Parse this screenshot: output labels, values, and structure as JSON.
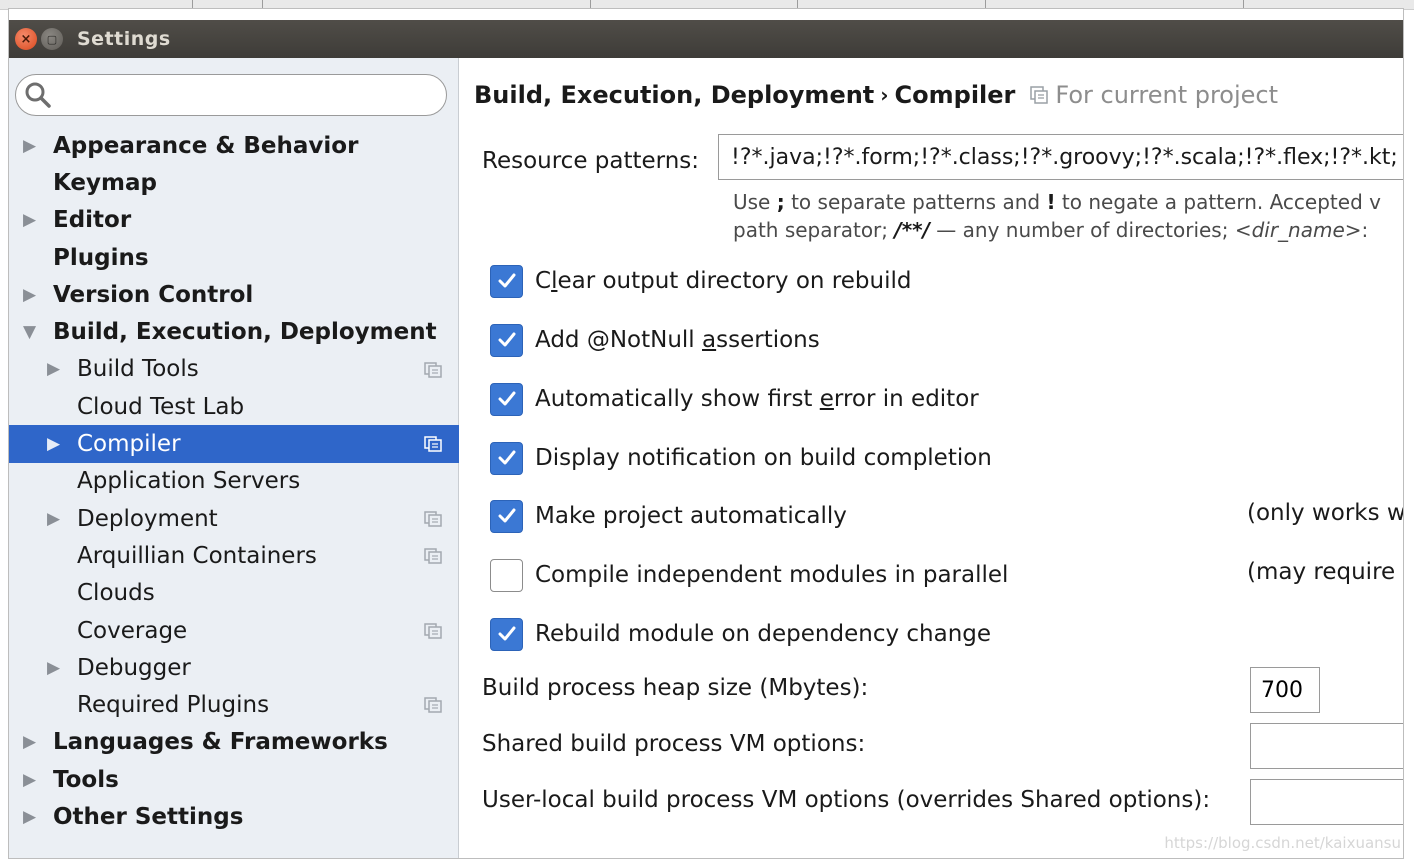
{
  "window": {
    "title": "Settings",
    "close_glyph": "×",
    "minimize_glyph": "▢"
  },
  "search": {
    "value": "",
    "placeholder": ""
  },
  "tree": [
    {
      "label": "Appearance & Behavior",
      "level": 0,
      "bold": true,
      "arrow": "▶",
      "proj": false,
      "selected": false
    },
    {
      "label": "Keymap",
      "level": 0,
      "bold": true,
      "arrow": "",
      "proj": false,
      "selected": false
    },
    {
      "label": "Editor",
      "level": 0,
      "bold": true,
      "arrow": "▶",
      "proj": false,
      "selected": false
    },
    {
      "label": "Plugins",
      "level": 0,
      "bold": true,
      "arrow": "",
      "proj": false,
      "selected": false
    },
    {
      "label": "Version Control",
      "level": 0,
      "bold": true,
      "arrow": "▶",
      "proj": false,
      "selected": false
    },
    {
      "label": "Build, Execution, Deployment",
      "level": 0,
      "bold": true,
      "arrow": "▼",
      "proj": false,
      "selected": false
    },
    {
      "label": "Build Tools",
      "level": 1,
      "bold": false,
      "arrow": "▶",
      "proj": true,
      "selected": false
    },
    {
      "label": "Cloud Test Lab",
      "level": 1,
      "bold": false,
      "arrow": "",
      "proj": false,
      "selected": false
    },
    {
      "label": "Compiler",
      "level": 1,
      "bold": false,
      "arrow": "▶",
      "proj": true,
      "selected": true
    },
    {
      "label": "Application Servers",
      "level": 1,
      "bold": false,
      "arrow": "",
      "proj": false,
      "selected": false
    },
    {
      "label": "Deployment",
      "level": 1,
      "bold": false,
      "arrow": "▶",
      "proj": true,
      "selected": false
    },
    {
      "label": "Arquillian Containers",
      "level": 1,
      "bold": false,
      "arrow": "",
      "proj": true,
      "selected": false
    },
    {
      "label": "Clouds",
      "level": 1,
      "bold": false,
      "arrow": "",
      "proj": false,
      "selected": false
    },
    {
      "label": "Coverage",
      "level": 1,
      "bold": false,
      "arrow": "",
      "proj": true,
      "selected": false
    },
    {
      "label": "Debugger",
      "level": 1,
      "bold": false,
      "arrow": "▶",
      "proj": false,
      "selected": false
    },
    {
      "label": "Required Plugins",
      "level": 1,
      "bold": false,
      "arrow": "",
      "proj": true,
      "selected": false
    },
    {
      "label": "Languages & Frameworks",
      "level": 0,
      "bold": true,
      "arrow": "▶",
      "proj": false,
      "selected": false
    },
    {
      "label": "Tools",
      "level": 0,
      "bold": true,
      "arrow": "▶",
      "proj": false,
      "selected": false
    },
    {
      "label": "Other Settings",
      "level": 0,
      "bold": true,
      "arrow": "▶",
      "proj": false,
      "selected": false
    }
  ],
  "breadcrumb": {
    "parent": "Build, Execution, Deployment",
    "separator": "›",
    "current": "Compiler",
    "scope": "For current project"
  },
  "resource": {
    "label": "Resource patterns:",
    "value": "!?*.java;!?*.form;!?*.class;!?*.groovy;!?*.scala;!?*.flex;!?*.kt;",
    "hint_line1_a": "Use ",
    "hint_line1_b": ";",
    "hint_line1_c": " to separate patterns and ",
    "hint_line1_d": "!",
    "hint_line1_e": " to negate a pattern. Accepted v",
    "hint_line2_a": "path separator; ",
    "hint_line2_b": "/**/",
    "hint_line2_c": " — any number of directories; ",
    "hint_line2_d": "<dir_name>",
    "hint_line2_e": ":"
  },
  "options": [
    {
      "pre": "C",
      "mn": "l",
      "post": "ear output directory on rebuild",
      "checked": true,
      "note": ""
    },
    {
      "pre": "Add @NotNull ",
      "mn": "a",
      "post": "ssertions",
      "checked": true,
      "note": ""
    },
    {
      "pre": "Automatically show first ",
      "mn": "e",
      "post": "rror in editor",
      "checked": true,
      "note": ""
    },
    {
      "pre": "Display notification on build completion",
      "mn": "",
      "post": "",
      "checked": true,
      "note": ""
    },
    {
      "pre": "Make project automatically",
      "mn": "",
      "post": "",
      "checked": true,
      "note": "(only works w"
    },
    {
      "pre": "Compile independent modules in parallel",
      "mn": "",
      "post": "",
      "checked": false,
      "note": "(may require"
    },
    {
      "pre": "Rebuild module on dependency change",
      "mn": "",
      "post": "",
      "checked": true,
      "note": ""
    }
  ],
  "heap": {
    "label": "Build process heap size (Mbytes):",
    "value": "700"
  },
  "shared_vm": {
    "label": "Shared build process VM options:",
    "value": ""
  },
  "user_vm": {
    "label": "User-local build process VM options (overrides Shared options):",
    "value": ""
  },
  "watermark": "https://blog.csdn.net/kaixuansu",
  "colors": {
    "selection": "#2f66c9",
    "checkbox": "#3b78d4",
    "sidebar_bg": "#ebeff4"
  }
}
